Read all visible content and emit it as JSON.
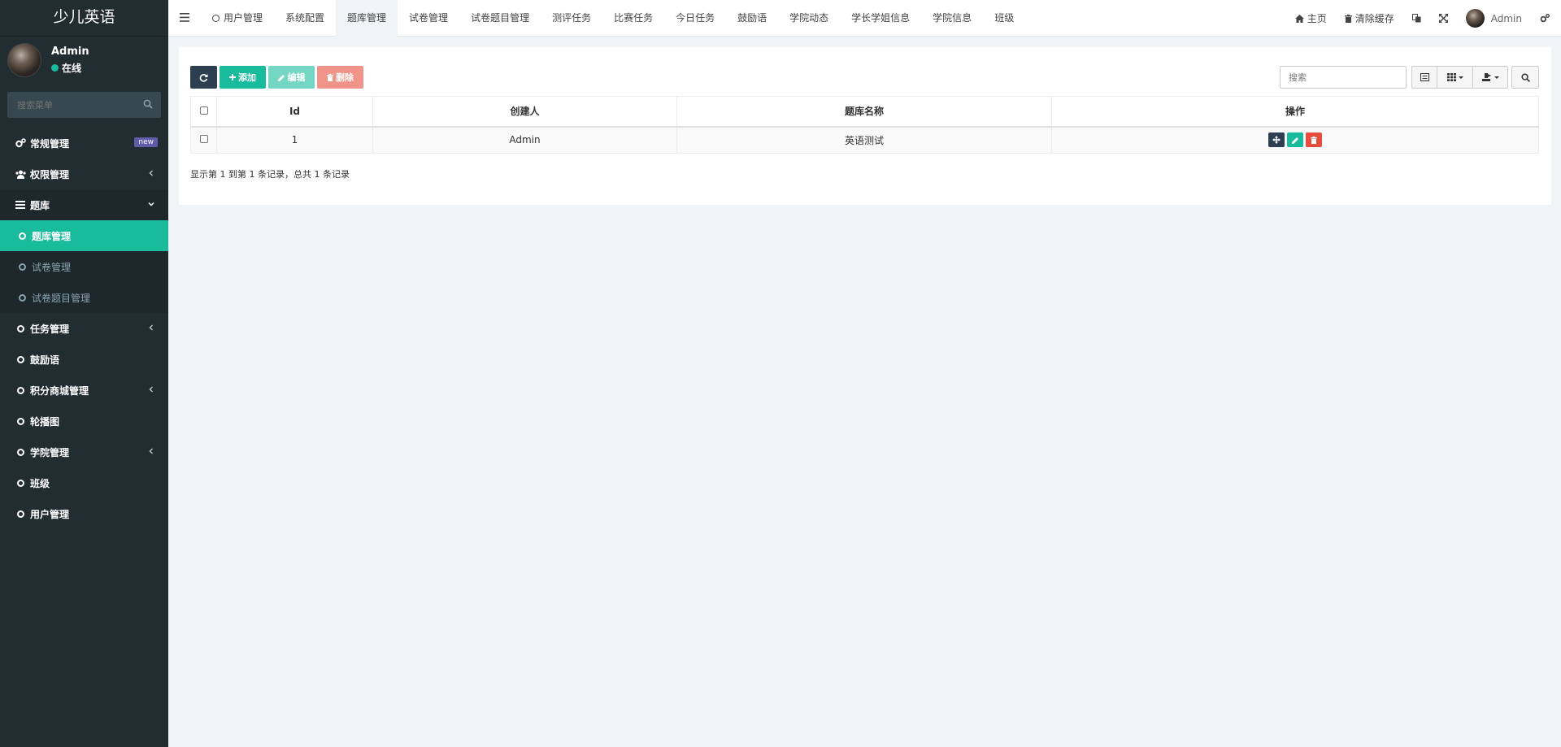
{
  "app": {
    "brand": "少儿英语"
  },
  "user": {
    "name": "Admin",
    "status": "在线"
  },
  "sidebar": {
    "search_placeholder": "搜索菜单",
    "items": [
      {
        "label": "常规管理",
        "icon": "cogs-icon",
        "badge": "new"
      },
      {
        "label": "权限管理",
        "icon": "users-icon"
      },
      {
        "label": "题库",
        "icon": "list-icon"
      },
      {
        "label": "任务管理",
        "icon": "circle-icon"
      },
      {
        "label": "鼓励语",
        "icon": "circle-icon"
      },
      {
        "label": "积分商城管理",
        "icon": "circle-icon"
      },
      {
        "label": "轮播图",
        "icon": "circle-icon"
      },
      {
        "label": "学院管理",
        "icon": "circle-icon"
      },
      {
        "label": "班级",
        "icon": "circle-icon"
      },
      {
        "label": "用户管理",
        "icon": "circle-icon"
      }
    ],
    "submenu": [
      {
        "label": "题库管理",
        "active": true
      },
      {
        "label": "试卷管理"
      },
      {
        "label": "试卷题目管理"
      }
    ]
  },
  "topbar": {
    "tabs": [
      "用户管理",
      "系统配置",
      "题库管理",
      "试卷管理",
      "试卷题目管理",
      "测评任务",
      "比赛任务",
      "今日任务",
      "鼓励语",
      "学院动态",
      "学长学姐信息",
      "学院信息",
      "班级"
    ],
    "active_tab": "题库管理",
    "home": "主页",
    "clear_cache": "清除缓存",
    "user": "Admin"
  },
  "toolbar": {
    "add": "添加",
    "edit": "编辑",
    "delete": "删除",
    "search_placeholder": "搜索"
  },
  "table": {
    "columns": [
      "Id",
      "创建人",
      "题库名称",
      "操作"
    ],
    "rows": [
      {
        "id": "1",
        "creator": "Admin",
        "name": "英语测试"
      }
    ]
  },
  "pagination": {
    "info": "显示第 1 到第 1 条记录，总共 1 条记录"
  },
  "colors": {
    "sidebar_bg": "#222d32",
    "accent": "#18bc9c",
    "danger": "#e74c3c",
    "primary_dark": "#2c3e50",
    "badge": "#605ca8"
  }
}
